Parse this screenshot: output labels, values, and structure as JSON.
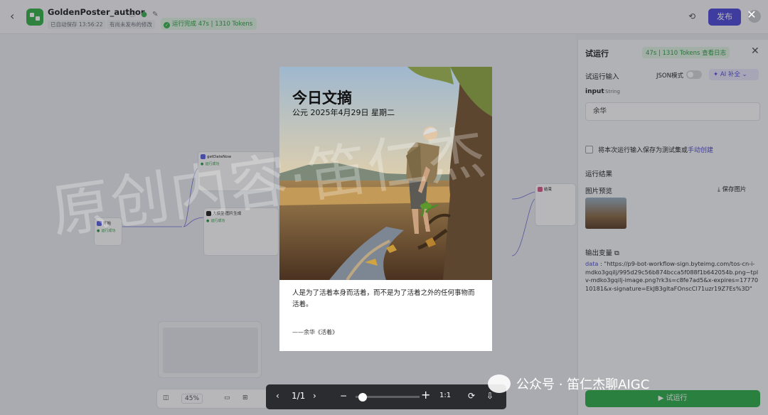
{
  "header": {
    "title": "GoldenPoster_author",
    "autosave": "已自动保存 13:56:22",
    "unpublished": "有尚未发布的修改",
    "run_status": "运行完成 47s | 1310 Tokens",
    "publish_label": "发布"
  },
  "canvas": {
    "nodes": {
      "n1_title": "getDateNow",
      "n1_status": "运行成功",
      "n2_title": "大模型·图片生成",
      "n2_status": "运行成功",
      "n3_title": "开始",
      "n3_status": "运行成功",
      "n4_title": "结束"
    },
    "zoom": "45%",
    "run_label": "试运行"
  },
  "panel": {
    "title": "试运行",
    "badge": "47s | 1310 Tokens  查看日志",
    "input_section": "试运行输入",
    "json_mode": "JSON模式",
    "ai_fill": "AI 补全",
    "input_name": "input",
    "input_type": "String",
    "input_value": "余华",
    "save_testset": "将本次运行输入保存为测试集或",
    "manual_create": "手动创建",
    "result_title": "运行结果",
    "preview_title": "图片预览",
    "save_image": "保存图片",
    "output_title": "输出变量",
    "output_key": "data",
    "output_value": "\"https://p9-bot-workflow-sign.byteimg.com/tos-cn-i-mdko3gqilj/995d29c56b874bcca5f088f1b642054b.png~tplv-mdko3gqilj-image.png?rk3s=c8fe7ad5&x-expires=1777010181&x-signature=EkJB3gItaFOnscCl71uzr19Z7Es%3D\"",
    "run_button": "试运行"
  },
  "poster": {
    "heading": "今日文摘",
    "date": "公元 2025年4月29日 星期二",
    "quote": "人是为了活着本身而活着，而不是为了活着之外的任何事物而活着。",
    "source": "——余华《活着》"
  },
  "viewer": {
    "page": "1/1",
    "zoom_knob": 0.05
  },
  "watermark": "原创内容·笛仁杰",
  "brand": "公众号 · 笛仁杰聊AIGC",
  "colors": {
    "accent": "#4e4bd9",
    "success": "#2fae4c"
  }
}
